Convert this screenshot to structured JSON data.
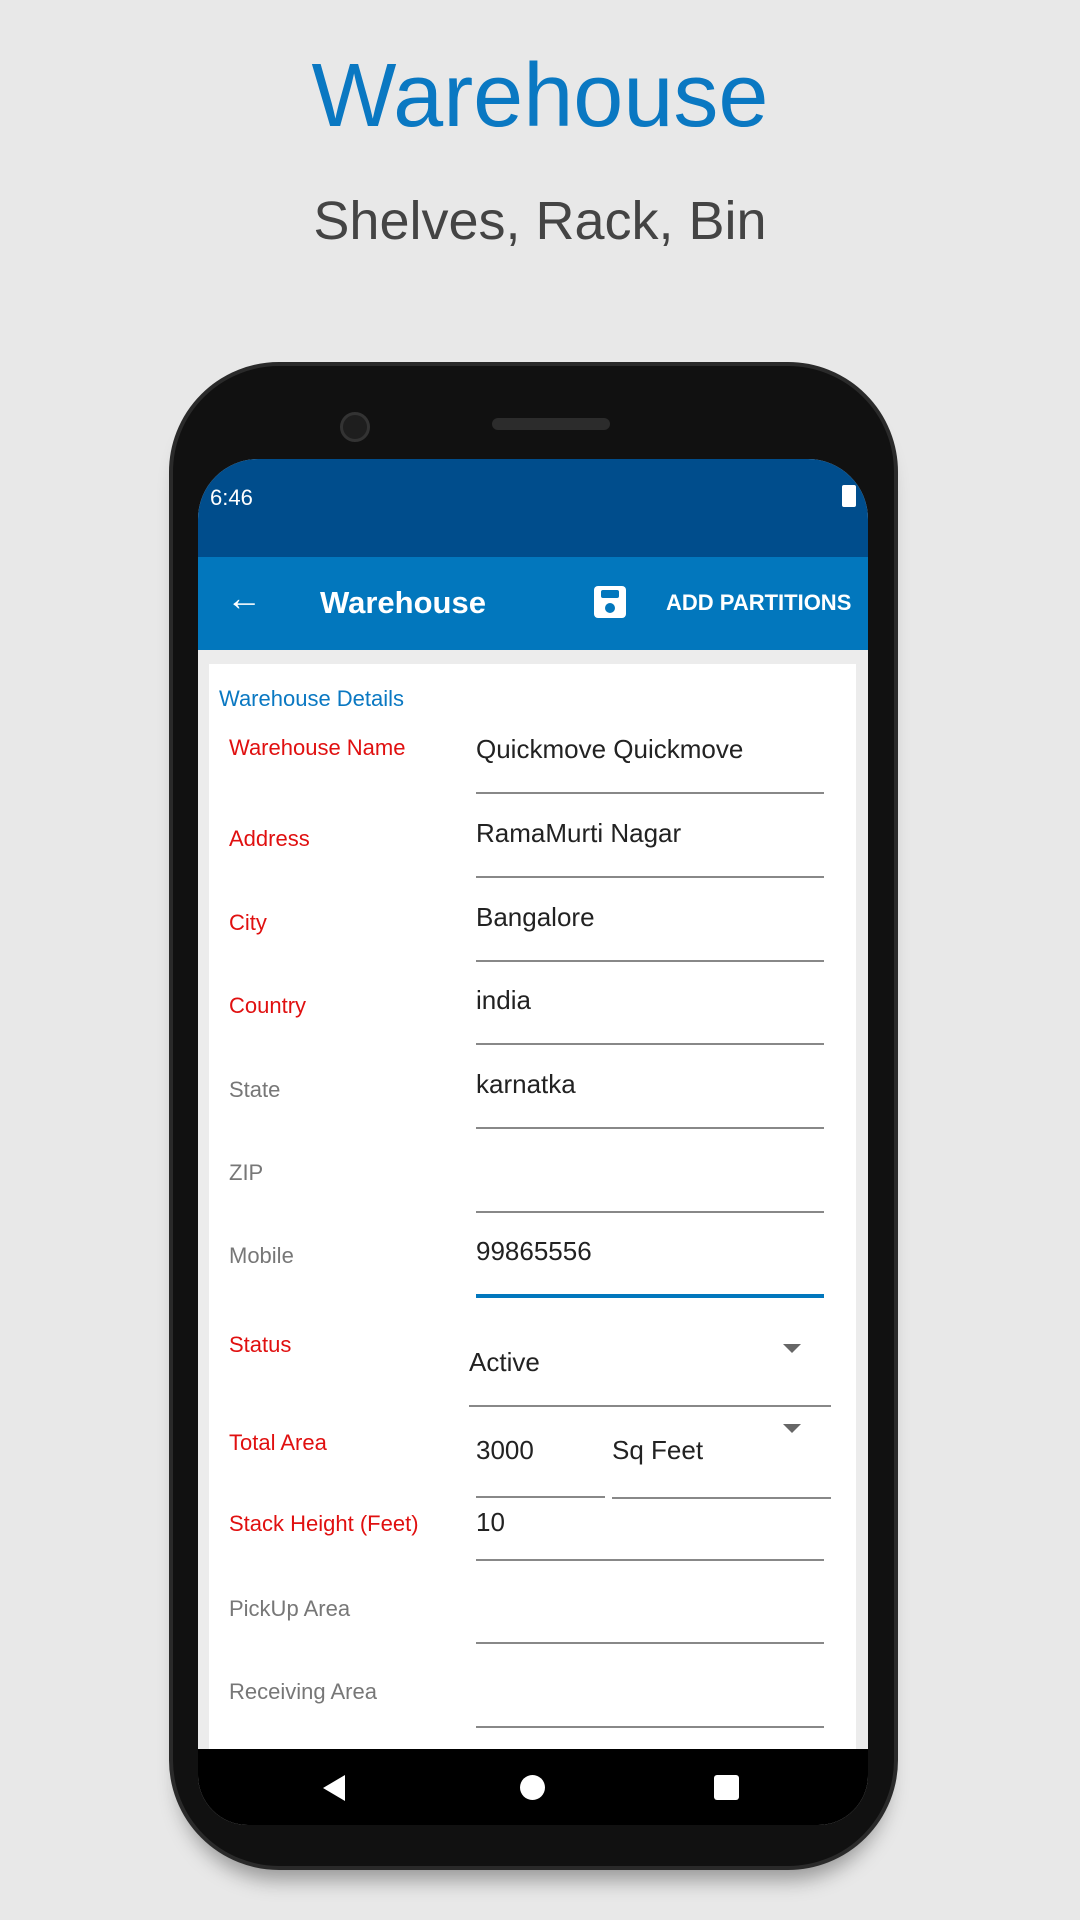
{
  "hero": {
    "title": "Warehouse",
    "subtitle": "Shelves, Rack, Bin"
  },
  "statusbar": {
    "time": "6:46"
  },
  "toolbar": {
    "title": "Warehouse",
    "action": "ADD PARTITIONS"
  },
  "form": {
    "section": "Warehouse Details",
    "fields": [
      {
        "label": "Warehouse Name",
        "value": "Quickmove Quickmove",
        "required": true
      },
      {
        "label": "Address",
        "value": "RamaMurti Nagar",
        "required": true
      },
      {
        "label": "City",
        "value": "Bangalore",
        "required": true
      },
      {
        "label": "Country",
        "value": "india",
        "required": true
      },
      {
        "label": "State",
        "value": "karnatka",
        "required": false
      },
      {
        "label": "ZIP",
        "value": "",
        "required": false
      },
      {
        "label": "Mobile",
        "value": "99865556",
        "required": false,
        "focused": true
      },
      {
        "label": "Status",
        "value": "Active",
        "required": true
      },
      {
        "label": "Total Area",
        "value": "3000",
        "unit": "Sq Feet",
        "required": true
      },
      {
        "label": "Stack Height (Feet)",
        "value": "10",
        "required": true
      },
      {
        "label": "PickUp Area",
        "value": "",
        "required": false
      },
      {
        "label": "Receiving Area",
        "value": "",
        "required": false
      }
    ]
  },
  "colors": {
    "accent": "#0277bd",
    "statusbar": "#004d8c",
    "required": "#e01010"
  }
}
